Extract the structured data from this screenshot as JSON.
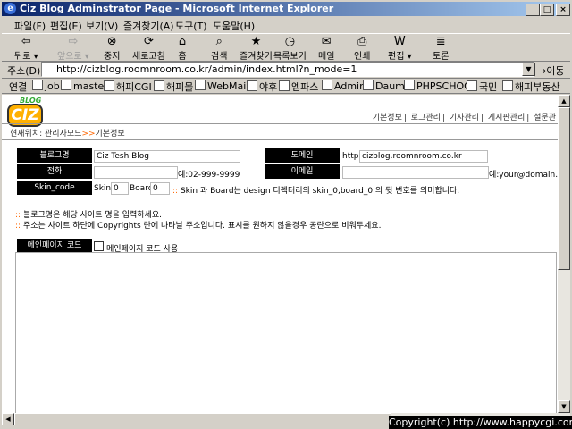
{
  "window": {
    "title": "Ciz Blog Adminstrator Page - Microsoft Internet Explorer",
    "minimize": "_",
    "maximize": "□",
    "close": "×"
  },
  "menu": [
    "파일(F)",
    "편집(E)",
    "보기(V)",
    "즐겨찾기(A)",
    "도구(T)",
    "도움말(H)"
  ],
  "toolbar": {
    "back": "뒤로",
    "forward": "앞으로",
    "stop": "중지",
    "refresh": "새로고침",
    "home": "홈",
    "search": "검색",
    "favorites": "즐겨찾기",
    "history": "목록보기",
    "mail": "메일",
    "print": "인쇄",
    "edit": "편집",
    "discuss": "토론"
  },
  "address": {
    "label": "주소(D)",
    "url": "http://cizblog.roomnroom.co.kr/admin/index.html?n_mode=1",
    "go": "이동"
  },
  "links": {
    "label": "연결",
    "items": [
      "job",
      "master",
      "해피CGI",
      "해피몰",
      "WebMail",
      "야후",
      "엠파스",
      "Admin",
      "Daum",
      "PHPSCHOOL",
      "국민",
      "해피부동산"
    ]
  },
  "page": {
    "logo_small": "BLOG",
    "logo_big": "CIZ",
    "topnav": [
      "기본정보",
      "로그관리",
      "기사관리",
      "게시판관리",
      "설문관"
    ],
    "crumb_label": "현재위치:",
    "crumb_path": "관리자모드",
    "crumb_sep": ">>",
    "crumb_current": "기본정보",
    "form": {
      "blog_name_label": "블로그명",
      "blog_name_value": "Ciz Tesh Blog",
      "domain_label": "도메인",
      "domain_prefix": "http://",
      "domain_value": "cizblog.roomnroom.co.kr",
      "phone_label": "전화",
      "phone_hint": "예:02-999-9999",
      "email_label": "이메일",
      "email_hint": "예:your@domain.com",
      "skin_label": "Skin_code",
      "skin_text": "Skin",
      "skin_value": "0",
      "board_text": "Board",
      "board_value": "0",
      "skin_note": "Skin 과 Board는 design 디렉터리의 skin_0,board_0 의 뒷 번호를 의미합니다."
    },
    "notes": [
      "블로그명은 해당 사이트 명을 입력하세요.",
      "주소는 사이트 하단에 Copyrights 란에 나타날 주소입니다. 표시를 원하지 않을경우 공란으로 비워두세요."
    ],
    "main_code_label": "메인페이지 코드",
    "main_code_checkbox": "메인페이지 코드 사용"
  },
  "status": {
    "copyright": "Copyright(c) http://www.happycgi.com"
  }
}
